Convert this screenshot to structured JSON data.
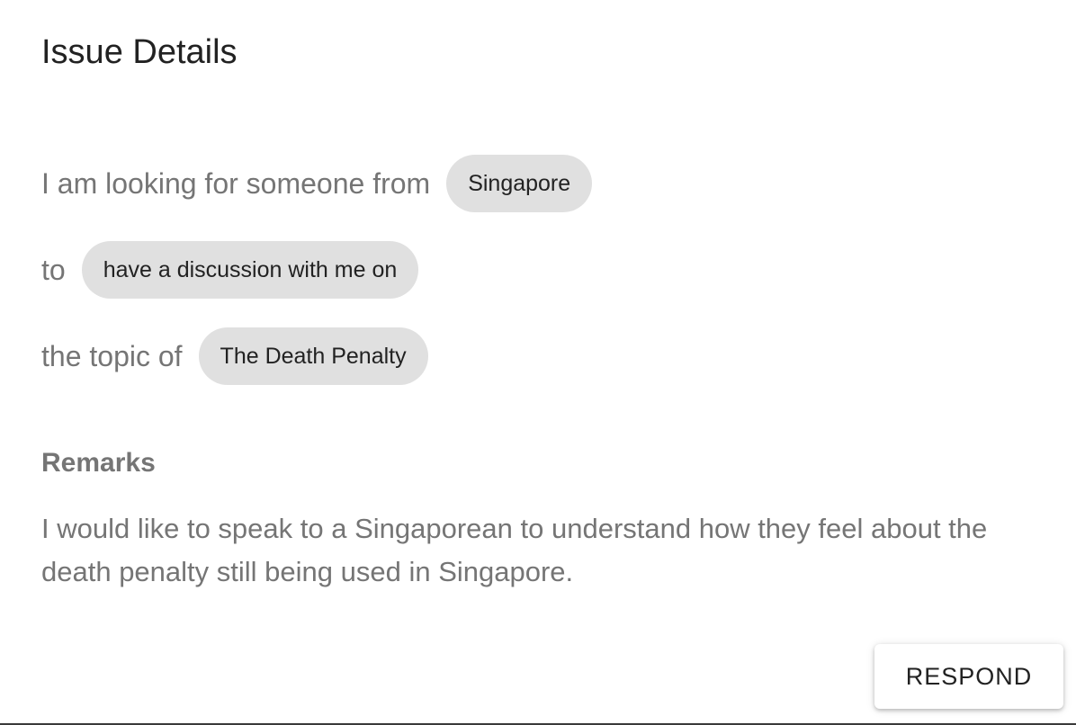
{
  "dialog": {
    "title": "Issue Details"
  },
  "request": {
    "country_lead": "I am looking for someone from",
    "country": "Singapore",
    "purpose_lead": "to",
    "purpose": "have a discussion with me on",
    "topic_lead": "the topic of",
    "topic": "The Death Penalty"
  },
  "remarks": {
    "heading": "Remarks",
    "text": "I would like to speak to a Singaporean to understand how they feel about the death penalty still being used in Singapore."
  },
  "actions": {
    "respond_label": "RESPOND"
  }
}
